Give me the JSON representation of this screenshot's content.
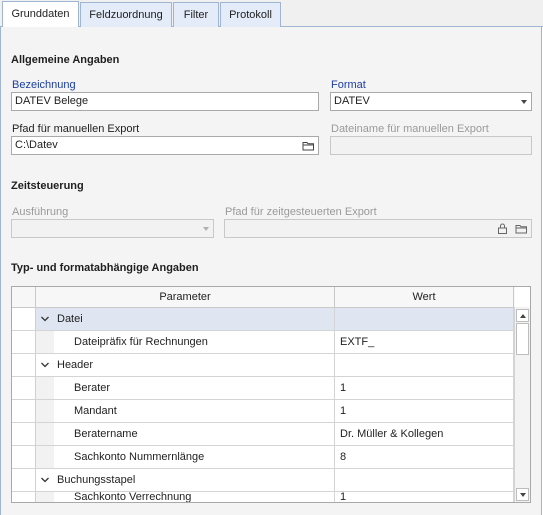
{
  "tabs": [
    {
      "label": "Grunddaten"
    },
    {
      "label": "Feldzuordnung"
    },
    {
      "label": "Filter"
    },
    {
      "label": "Protokoll"
    }
  ],
  "general": {
    "title": "Allgemeine Angaben",
    "bezeichnung_label": "Bezeichnung",
    "bezeichnung_value": "DATEV Belege",
    "format_label": "Format",
    "format_value": "DATEV",
    "pfad_label": "Pfad für manuellen Export",
    "pfad_value": "C:\\Datev",
    "dateiname_label": "Dateiname für manuellen Export",
    "dateiname_value": ""
  },
  "zeit": {
    "title": "Zeitsteuerung",
    "ausfuehrung_label": "Ausführung",
    "ausfuehrung_value": "",
    "pfad_label": "Pfad für zeitgesteuerten Export",
    "pfad_value": ""
  },
  "typ": {
    "title": "Typ- und formatabhängige Angaben",
    "columns": {
      "param": "Parameter",
      "wert": "Wert"
    },
    "rows": [
      {
        "kind": "group",
        "label": "Datei",
        "value": ""
      },
      {
        "kind": "item",
        "label": "Dateipräfix für Rechnungen",
        "value": "EXTF_"
      },
      {
        "kind": "group",
        "label": "Header",
        "value": ""
      },
      {
        "kind": "item",
        "label": "Berater",
        "value": "1"
      },
      {
        "kind": "item",
        "label": "Mandant",
        "value": "1"
      },
      {
        "kind": "item",
        "label": "Beratername",
        "value": "Dr. Müller & Kollegen"
      },
      {
        "kind": "item",
        "label": "Sachkonto Nummernlänge",
        "value": "8"
      },
      {
        "kind": "group",
        "label": "Buchungsstapel",
        "value": ""
      },
      {
        "kind": "item",
        "label": "Sachkonto Verrechnung",
        "value": "1"
      }
    ]
  },
  "icons": {
    "folder": "folder-icon",
    "lock": "lock-icon",
    "chevron": "chevron-down-icon",
    "scroll_up": "scroll-up-icon",
    "scroll_down": "scroll-down-icon"
  },
  "colors": {
    "label_blue": "#1b3fa0",
    "tab_inactive": "#e3ecf8",
    "group_row_highlight": "#dfe6f1"
  }
}
